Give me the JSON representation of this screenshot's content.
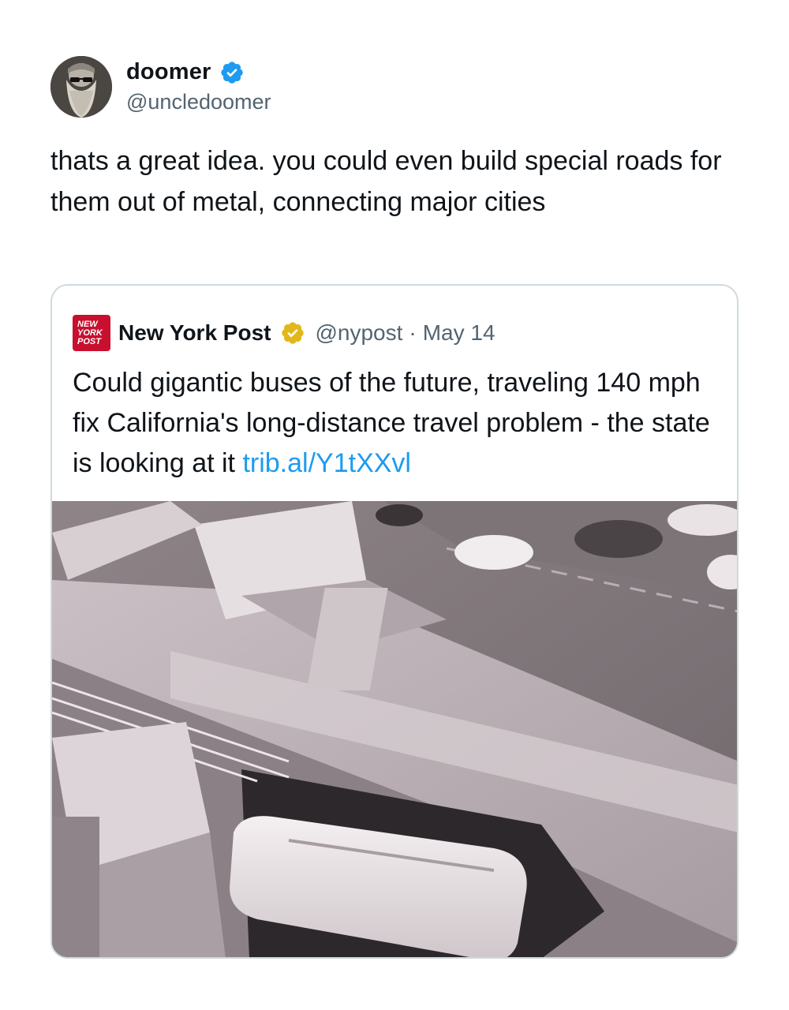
{
  "tweet": {
    "display_name": "doomer",
    "handle": "@uncledoomer",
    "text": "thats a great idea. you could even build special roads for them out of metal, connecting major cities",
    "verified_icon": "verified-blue-check",
    "avatar_icon": "avatar-bearded-man-sunglasses"
  },
  "quote": {
    "display_name": "New York Post",
    "handle": "@nypost",
    "separator": "·",
    "date": "May 14",
    "text": "Could gigantic buses of the future, traveling 140 mph fix California's long-distance travel problem - the state is looking at it",
    "link": "trib.al/Y1tXXvl",
    "logo_text": "NEW YORK POST",
    "verified_icon": "verified-gold-check",
    "media_icon": "aerial-highway-bus-image"
  },
  "colors": {
    "text": "#0f1419",
    "muted": "#536471",
    "link": "#1d9bf0",
    "border": "#cfd9de",
    "verified_blue": "#1d9bf0",
    "verified_gold": "#e2b719",
    "nypost_red": "#c8102e"
  }
}
